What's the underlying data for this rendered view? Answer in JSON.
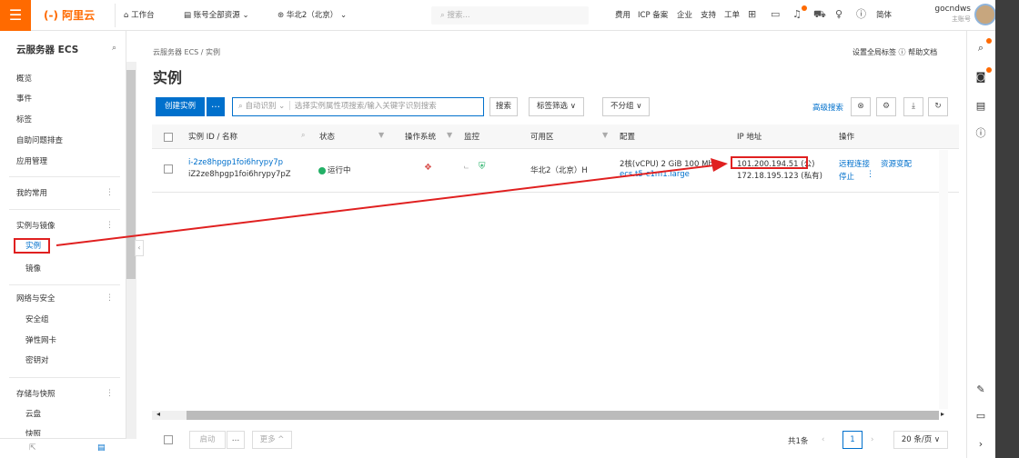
{
  "topbar": {
    "logo": "(-) 阿里云",
    "workbench": "工作台",
    "account_resources": "账号全部资源",
    "region": "华北2（北京）",
    "search_placeholder": "搜索...",
    "nav": [
      "费用",
      "ICP 备案",
      "企业",
      "支持",
      "工单"
    ],
    "lang": "简体",
    "user_name": "gocndws",
    "user_role": "主账号"
  },
  "sidebar": {
    "title": "云服务器 ECS",
    "items": [
      "概览",
      "事件",
      "标签",
      "自助问题排查",
      "应用管理"
    ],
    "favorites": "我的常用",
    "group1": {
      "label": "实例与镜像",
      "items": [
        "实例",
        "镜像"
      ]
    },
    "group2": {
      "label": "网络与安全",
      "items": [
        "安全组",
        "弹性网卡",
        "密钥对"
      ]
    },
    "group3": {
      "label": "存储与快照",
      "items": [
        "云盘",
        "快照"
      ]
    }
  },
  "main": {
    "breadcrumb": "云服务器 ECS / 实例",
    "title": "实例",
    "header_links": "设置全局标签  ⓘ 帮助文档",
    "create_btn": "创建实例",
    "search_mode": "自动识别",
    "search_placeholder": "选择实例属性项搜索/输入关键字识别搜索",
    "search_btn": "搜索",
    "tag_filter": "标签筛选",
    "group_filter": "不分组",
    "adv_search": "高级搜索"
  },
  "table": {
    "columns": [
      "实例 ID / 名称",
      "状态",
      "操作系统",
      "监控",
      "可用区",
      "配置",
      "IP 地址",
      "操作"
    ],
    "row": {
      "id": "i-2ze8hpgp1foi6hrypy7p",
      "name": "iZ2ze8hpgp1foi6hrypy7pZ",
      "status": "运行中",
      "zone": "华北2（北京）H",
      "config": "2核(vCPU)  2 GiB  100 Mbps",
      "spec": "ecs.t5-c1m1.large",
      "ip_public": "101.200.194.51 (公)",
      "ip_private": "172.18.195.123 (私有)",
      "actions": [
        "远程连接",
        "资源变配",
        "停止"
      ]
    }
  },
  "footer": {
    "start": "启动",
    "more": "更多",
    "total": "共1条",
    "page": "1",
    "per_page": "20 条/页"
  },
  "colors": {
    "brand": "#ff6a00",
    "primary": "#0070cc",
    "annotation": "#e02020",
    "running": "#23b066"
  }
}
